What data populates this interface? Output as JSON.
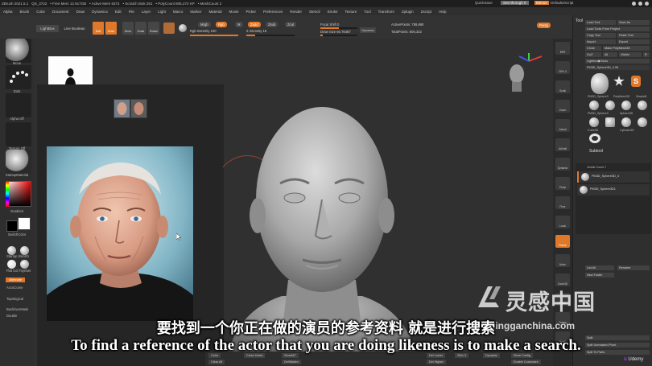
{
  "titlebar": {
    "app": "ZBrush 2021.5.1",
    "file": "QS_3722",
    "free_mem": "• Free Mem 12.917GB",
    "active_mem": "• Active Mem 6374",
    "scratch": "• Scratch Disk 281",
    "polycount": "• PolyCount 806,272 KP",
    "meshcount": "• MeshCount 2",
    "quicksave": "QuickSave",
    "see_through": "See-through  0",
    "menus": "Menus",
    "default_zscript": "DefaultZScript"
  },
  "menubar": [
    "Alpha",
    "Brush",
    "Color",
    "Document",
    "Draw",
    "Dynamics",
    "Edit",
    "File",
    "Layer",
    "Light",
    "Macro",
    "Marker",
    "Material",
    "Movie",
    "Picker",
    "Preferences",
    "Render",
    "Stencil",
    "Stroke",
    "Texture",
    "Tool",
    "Transform",
    "Zplugin",
    "Zscript",
    "Help"
  ],
  "shelf": {
    "lightbox": "LightBox",
    "live_boolean": "Live Boolean",
    "buttons": [
      "Edit",
      "Draw",
      "Move",
      "Scale",
      "Rotate"
    ],
    "mrgb": "Mrgb",
    "rgb": "Rgb",
    "m": "M",
    "zadd": "Zadd",
    "zsub": "Zsub",
    "zcut": "Zcut",
    "rgb_intensity": "Rgb Intensity 100",
    "z_intensity": "Z Intensity 19",
    "focal_shift": "Focal Shift 0",
    "draw_size": "Draw Size 60.76487",
    "dynamic": "Dynamic",
    "active_points": "ActivePoints: 789,890",
    "total_points": "TotalPoints: 806,322",
    "persp": "Persp"
  },
  "left_panel": {
    "move": "Move",
    "dots": "Dots",
    "alpha_off": "Alpha Off",
    "texture_off": "Texture Off",
    "startup_material": "StartupMaterial",
    "gradient": "Gradient",
    "switch_color": "SwitchColor",
    "alternate": "Alternate",
    "startup_skin": "Startup SkinSh",
    "flat_color": "Flat Col Toyn5er",
    "accucurve": "AccuCurve",
    "topological": "Topological",
    "backface_mask": "BackfaceMask",
    "double": "Double"
  },
  "right_strip": [
    "BPR",
    "SPix 3",
    "Scroll",
    "Zoom",
    "Actual",
    "AAHalf",
    "Dynamic",
    "Persp",
    "Floor",
    "Local",
    "Frame",
    "Move",
    "Zoom3D",
    "Rotate",
    "Transp",
    "PolyF"
  ],
  "tool_palette": {
    "title": "Tool",
    "load_tool": "Load Tool",
    "save_as": "Save As",
    "load_from_project": "Load Tools From Project",
    "copy_tool": "Copy Tool",
    "paste_tool": "Paste Tool",
    "import": "Import",
    "export": "Export",
    "clone": "Clone",
    "make_polymesh": "Make PolyMesh3D",
    "goz": "GoZ",
    "all": "All",
    "visible": "Visible",
    "r": "R",
    "lightbox_tools": "Lightbox▶Tools",
    "current_tool": "PM3D_Sphere3D_4 55",
    "thumb_labels": [
      "PM3D_Sphere3",
      "PolyMesh3D",
      "SimpleB",
      "PM3D_Sphere3",
      "Sphere3D",
      "PM3D_Sphere",
      "Cube3D",
      "PM3D_1",
      "Cylinder3D",
      "Sphere3D",
      "PM3D_1",
      "Ring3D"
    ],
    "subtool": "Subtool",
    "visible_count": "Visible Count 7",
    "subtools": [
      "PM3D_Sphere3D_4",
      "PM3D_Sphere3D1"
    ],
    "list_all": "List All",
    "new_folder": "New Folder",
    "rename": "Rename",
    "split": "Split",
    "split_unmasked": "Split Unmasked Point",
    "split_to_parts": "Split To Parts"
  },
  "bottom_shelf": [
    "Color",
    "Clear All",
    "Close Holes",
    "StoreMT",
    "DelHidden",
    "Del Lower",
    "Dynamic",
    "Store Config",
    "Enable Customize",
    "Del Higher",
    "SDiv 0"
  ],
  "subtitles": {
    "chinese": "要找到一个你正在做的演员的参考资料 就是进行搜索",
    "english": "To find a reference of the actor that you are doing likeness is to make a search."
  },
  "watermark": {
    "site_name": "灵感中国",
    "url": "lingganchina.com"
  },
  "udemy": "Udemy",
  "colors": {
    "accent": "#e0782a",
    "bg": "#2b2b2b",
    "panel": "#2f2f2f"
  }
}
